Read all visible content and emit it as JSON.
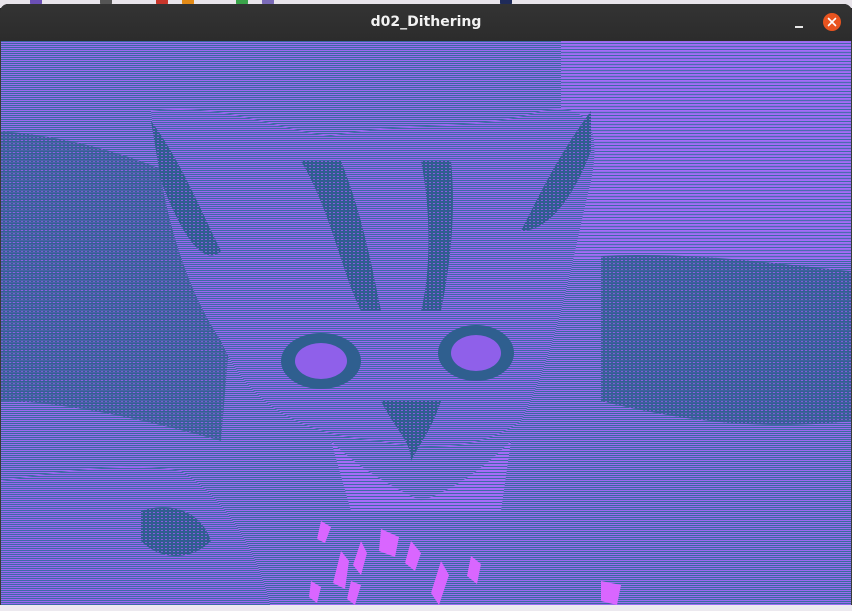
{
  "window": {
    "title": "d02_Dithering"
  },
  "controls": {
    "minimize_icon": "minimize-icon",
    "close_icon": "close-icon"
  },
  "canvas": {
    "content": "dithered-kitten-image",
    "colors": {
      "light": "#b06cff",
      "dark": "#2f5f8f",
      "highlight": "#d966ff"
    }
  }
}
